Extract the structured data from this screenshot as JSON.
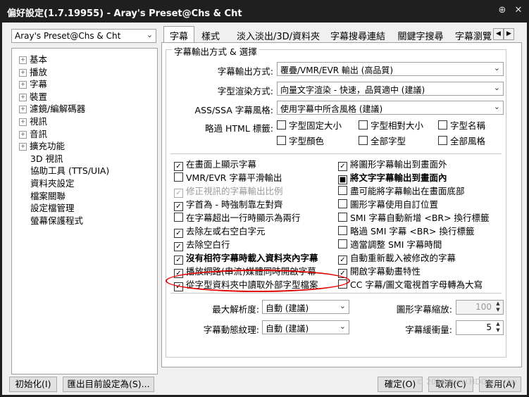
{
  "window": {
    "title": "偏好設定(1.7.19955) - Aray's Preset@Chs & Cht",
    "pin_icon": "pin-icon",
    "close_icon": "close-icon"
  },
  "preset_selector": {
    "value": "Aray's Preset@Chs & Cht"
  },
  "tree": {
    "items": [
      {
        "label": "基本",
        "expandable": true
      },
      {
        "label": "播放",
        "expandable": true
      },
      {
        "label": "字幕",
        "expandable": true
      },
      {
        "label": "裝置",
        "expandable": true
      },
      {
        "label": "濾鏡/編解碼器",
        "expandable": true
      },
      {
        "label": "視訊",
        "expandable": true
      },
      {
        "label": "音訊",
        "expandable": true
      },
      {
        "label": "擴充功能",
        "expandable": true
      },
      {
        "label": "3D 視訊",
        "expandable": false
      },
      {
        "label": "協助工具 (TTS/UIA)",
        "expandable": false
      },
      {
        "label": "資料夾設定",
        "expandable": false
      },
      {
        "label": "檔案關聯",
        "expandable": false
      },
      {
        "label": "設定檔管理",
        "expandable": false
      },
      {
        "label": "螢幕保護程式",
        "expandable": false
      }
    ]
  },
  "tabs": [
    "字幕",
    "樣式",
    "淡入淡出/3D/資料夾",
    "字幕搜尋連結",
    "關鍵字搜尋",
    "字幕瀏覽"
  ],
  "group_title": "字幕輸出方式 & 選擇",
  "settings": {
    "output_label": "字幕輸出方式:",
    "output_value": "覆疊/VMR/EVR 輸出 (高品質)",
    "render_label": "字型渲染方式:",
    "render_value": "向量文字渲染 - 快速，品質適中 (建議)",
    "ass_label": "ASS/SSA 字幕風格:",
    "ass_value": "使用字幕中所含風格 (建議)",
    "html_label": "略過 HTML 標籤:",
    "html_tags": [
      "字型固定大小",
      "字型相對大小",
      "字型名稱",
      "字型顏色",
      "全部字型",
      "全部風格"
    ]
  },
  "checkboxes_left": [
    {
      "label": "在畫面上顯示字幕",
      "checked": true
    },
    {
      "label": "VMR/EVR 字幕平滑輸出",
      "checked": false
    },
    {
      "label": "修正視訊的字幕輸出比例",
      "checked": true,
      "disabled": true
    },
    {
      "label": "字首為 - 時強制靠左對齊",
      "checked": true
    },
    {
      "label": "在字幕超出一行時顯示為兩行",
      "checked": false
    },
    {
      "label": "去除左或右空白字元",
      "checked": true
    },
    {
      "label": "去除空白行",
      "checked": true
    },
    {
      "label": "沒有相符字幕時載入資料夾內字幕",
      "checked": true,
      "bold": true
    },
    {
      "label": "播放網路(串流)媒體同時開啟字幕",
      "checked": true
    },
    {
      "label": "從字型資料夾中讀取外部字型檔案",
      "checked": true
    }
  ],
  "checkboxes_right": [
    {
      "label": "將圖形字幕輸出到畫面外",
      "checked": true
    },
    {
      "label": "將文字字幕輸出到畫面內",
      "checked": false,
      "bold": true,
      "partial": true
    },
    {
      "label": "盡可能將字幕輸出在畫面底部",
      "checked": false
    },
    {
      "label": "圖形字幕使用自訂位置",
      "checked": false
    },
    {
      "label": "SMI 字幕自動新增 <BR> 換行標籤",
      "checked": false
    },
    {
      "label": "略過 SMI 字幕 <BR> 換行標籤",
      "checked": false
    },
    {
      "label": "適當調整 SMI 字幕時間",
      "checked": false
    },
    {
      "label": "自動重新載入被修改的字幕",
      "checked": true
    },
    {
      "label": "開啟字幕動畫特性",
      "checked": true
    },
    {
      "label": "CC 字幕/圖文電視首字母轉為大寫",
      "checked": false
    }
  ],
  "bottom": {
    "max_res_label": "最大解析度:",
    "max_res_value": "自動 (建議)",
    "texture_label": "字幕動態紋理:",
    "texture_value": "自動 (建議)",
    "scale_label": "圖形字幕縮放:",
    "scale_value": "100",
    "buffer_label": "字幕緩衝量:",
    "buffer_value": "5"
  },
  "footer": {
    "init": "初始化(I)",
    "export": "匯出目前設定為(S)...",
    "ok": "確定(O)",
    "cancel": "取消(C)",
    "apply": "套用(A)"
  },
  "watermark": "© 2018 www.HDGunny.tw",
  "accent": "#e00000"
}
